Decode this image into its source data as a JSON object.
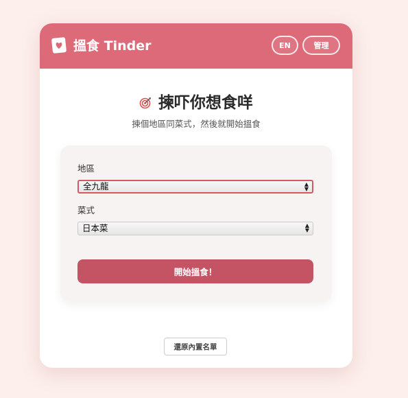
{
  "header": {
    "app_title": "搵食 Tinder",
    "lang_button": "EN",
    "admin_button": "管理"
  },
  "main": {
    "title": "揀吓你想食咩",
    "subtitle": "揀個地區同菜式，然後就開始搵食"
  },
  "form": {
    "region_label": "地區",
    "region_value": "全九龍",
    "cuisine_label": "菜式",
    "cuisine_value": "日本菜",
    "start_button": "開始搵食！"
  },
  "footer": {
    "restore_button": "還原內置名單"
  },
  "colors": {
    "header": "#dd6a78",
    "start_button": "#c45363",
    "background": "#fcefec"
  },
  "icons": {
    "logo": "heart-card-icon",
    "title": "target-icon"
  }
}
